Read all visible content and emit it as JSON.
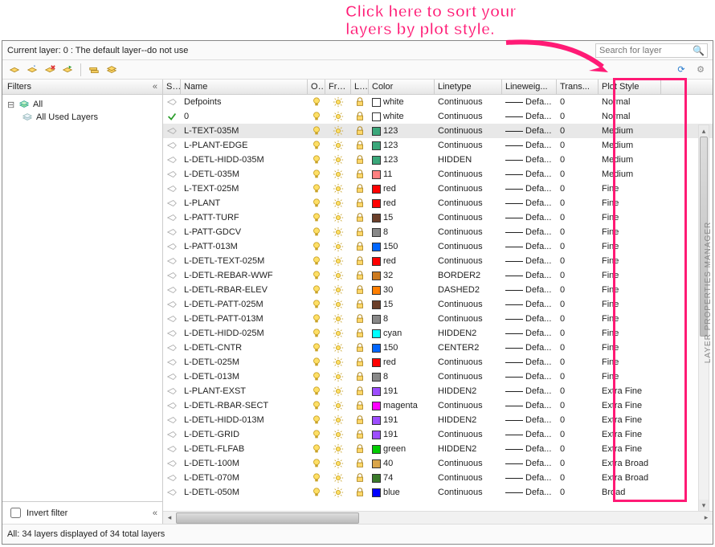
{
  "annotation": {
    "line1": "Click here to sort your",
    "line2": "layers by plot style."
  },
  "current_layer": "Current layer: 0 : The default layer--do not use",
  "search_placeholder": "Search for layer",
  "filters_title": "Filters",
  "tree": {
    "root": "All",
    "child1": "All Used Layers"
  },
  "invert_filter": "Invert filter",
  "columns": {
    "status": "S...",
    "name": "Name",
    "on": "O...",
    "freeze": "Fre...",
    "lock": "L...",
    "color": "Color",
    "linetype": "Linetype",
    "lineweight": "Lineweig...",
    "transparency": "Trans...",
    "plotstyle": "Plot Style"
  },
  "footer": "All: 34 layers displayed of 34 total layers",
  "side_label": "LAYER PROPERTIES MANAGER",
  "rows": [
    {
      "s": "rh",
      "name": "Defpoints",
      "color": "white",
      "hex": "#ffffff",
      "ltype": "Continuous",
      "lw": "Defa...",
      "tr": "0",
      "ps": "Normal"
    },
    {
      "s": "ck",
      "name": "0",
      "color": "white",
      "hex": "#ffffff",
      "ltype": "Continuous",
      "lw": "Defa...",
      "tr": "0",
      "ps": "Normal"
    },
    {
      "s": "rh",
      "name": "L-TEXT-035M",
      "color": "123",
      "hex": "#3aa77a",
      "ltype": "Continuous",
      "lw": "Defa...",
      "tr": "0",
      "ps": "Medium",
      "sel": true
    },
    {
      "s": "rh",
      "name": "L-PLANT-EDGE",
      "color": "123",
      "hex": "#3aa77a",
      "ltype": "Continuous",
      "lw": "Defa...",
      "tr": "0",
      "ps": "Medium"
    },
    {
      "s": "rh",
      "name": "L-DETL-HIDD-035M",
      "color": "123",
      "hex": "#3aa77a",
      "ltype": "HIDDEN",
      "lw": "Defa...",
      "tr": "0",
      "ps": "Medium"
    },
    {
      "s": "rh",
      "name": "L-DETL-035M",
      "color": "11",
      "hex": "#ff8080",
      "ltype": "Continuous",
      "lw": "Defa...",
      "tr": "0",
      "ps": "Medium"
    },
    {
      "s": "rh",
      "name": "L-TEXT-025M",
      "color": "red",
      "hex": "#ff0000",
      "ltype": "Continuous",
      "lw": "Defa...",
      "tr": "0",
      "ps": "Fine"
    },
    {
      "s": "rh",
      "name": "L-PLANT",
      "color": "red",
      "hex": "#ff0000",
      "ltype": "Continuous",
      "lw": "Defa...",
      "tr": "0",
      "ps": "Fine"
    },
    {
      "s": "rh",
      "name": "L-PATT-TURF",
      "color": "15",
      "hex": "#6b3f2a",
      "ltype": "Continuous",
      "lw": "Defa...",
      "tr": "0",
      "ps": "Fine"
    },
    {
      "s": "rh",
      "name": "L-PATT-GDCV",
      "color": "8",
      "hex": "#888888",
      "ltype": "Continuous",
      "lw": "Defa...",
      "tr": "0",
      "ps": "Fine"
    },
    {
      "s": "rh",
      "name": "L-PATT-013M",
      "color": "150",
      "hex": "#0066ff",
      "ltype": "Continuous",
      "lw": "Defa...",
      "tr": "0",
      "ps": "Fine"
    },
    {
      "s": "rh",
      "name": "L-DETL-TEXT-025M",
      "color": "red",
      "hex": "#ff0000",
      "ltype": "Continuous",
      "lw": "Defa...",
      "tr": "0",
      "ps": "Fine"
    },
    {
      "s": "rh",
      "name": "L-DETL-REBAR-WWF",
      "color": "32",
      "hex": "#cc7a1f",
      "ltype": "BORDER2",
      "lw": "Defa...",
      "tr": "0",
      "ps": "Fine"
    },
    {
      "s": "rh",
      "name": "L-DETL-RBAR-ELEV",
      "color": "30",
      "hex": "#ff7f00",
      "ltype": "DASHED2",
      "lw": "Defa...",
      "tr": "0",
      "ps": "Fine"
    },
    {
      "s": "rh",
      "name": "L-DETL-PATT-025M",
      "color": "15",
      "hex": "#6b3f2a",
      "ltype": "Continuous",
      "lw": "Defa...",
      "tr": "0",
      "ps": "Fine"
    },
    {
      "s": "rh",
      "name": "L-DETL-PATT-013M",
      "color": "8",
      "hex": "#888888",
      "ltype": "Continuous",
      "lw": "Defa...",
      "tr": "0",
      "ps": "Fine"
    },
    {
      "s": "rh",
      "name": "L-DETL-HIDD-025M",
      "color": "cyan",
      "hex": "#00ffff",
      "ltype": "HIDDEN2",
      "lw": "Defa...",
      "tr": "0",
      "ps": "Fine"
    },
    {
      "s": "rh",
      "name": "L-DETL-CNTR",
      "color": "150",
      "hex": "#0066ff",
      "ltype": "CENTER2",
      "lw": "Defa...",
      "tr": "0",
      "ps": "Fine"
    },
    {
      "s": "rh",
      "name": "L-DETL-025M",
      "color": "red",
      "hex": "#ff0000",
      "ltype": "Continuous",
      "lw": "Defa...",
      "tr": "0",
      "ps": "Fine"
    },
    {
      "s": "rh",
      "name": "L-DETL-013M",
      "color": "8",
      "hex": "#888888",
      "ltype": "Continuous",
      "lw": "Defa...",
      "tr": "0",
      "ps": "Fine"
    },
    {
      "s": "rh",
      "name": "L-PLANT-EXST",
      "color": "191",
      "hex": "#9d4dff",
      "ltype": "HIDDEN2",
      "lw": "Defa...",
      "tr": "0",
      "ps": "Extra Fine"
    },
    {
      "s": "rh",
      "name": "L-DETL-RBAR-SECT",
      "color": "magenta",
      "hex": "#ff00ff",
      "ltype": "Continuous",
      "lw": "Defa...",
      "tr": "0",
      "ps": "Extra Fine"
    },
    {
      "s": "rh",
      "name": "L-DETL-HIDD-013M",
      "color": "191",
      "hex": "#9d4dff",
      "ltype": "HIDDEN2",
      "lw": "Defa...",
      "tr": "0",
      "ps": "Extra Fine"
    },
    {
      "s": "rh",
      "name": "L-DETL-GRID",
      "color": "191",
      "hex": "#9d4dff",
      "ltype": "Continuous",
      "lw": "Defa...",
      "tr": "0",
      "ps": "Extra Fine"
    },
    {
      "s": "rh",
      "name": "L-DETL-FLFAB",
      "color": "green",
      "hex": "#00cc00",
      "ltype": "HIDDEN2",
      "lw": "Defa...",
      "tr": "0",
      "ps": "Extra Fine"
    },
    {
      "s": "rh",
      "name": "L-DETL-100M",
      "color": "40",
      "hex": "#d9a54a",
      "ltype": "Continuous",
      "lw": "Defa...",
      "tr": "0",
      "ps": "Extra Broad"
    },
    {
      "s": "rh",
      "name": "L-DETL-070M",
      "color": "74",
      "hex": "#3a7a2a",
      "ltype": "Continuous",
      "lw": "Defa...",
      "tr": "0",
      "ps": "Extra Broad"
    },
    {
      "s": "rh",
      "name": "L-DETL-050M",
      "color": "blue",
      "hex": "#0000ff",
      "ltype": "Continuous",
      "lw": "Defa...",
      "tr": "0",
      "ps": "Broad"
    }
  ]
}
